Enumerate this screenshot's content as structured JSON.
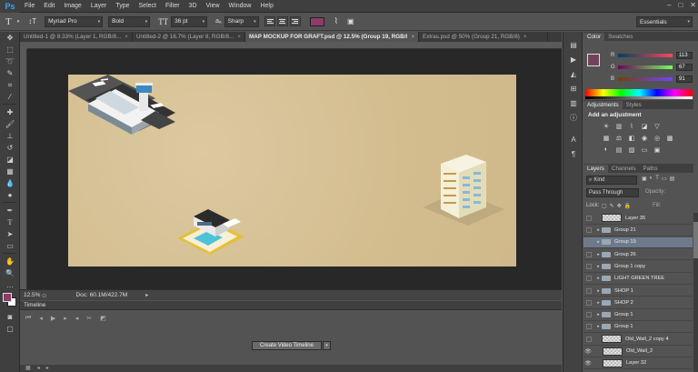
{
  "app": {
    "logo": "Ps"
  },
  "menu": [
    "File",
    "Edit",
    "Image",
    "Layer",
    "Type",
    "Select",
    "Filter",
    "3D",
    "View",
    "Window",
    "Help"
  ],
  "window_controls": [
    "–",
    "□",
    "✕"
  ],
  "options": {
    "font_family": "Myriad Pro",
    "font_style": "Bold",
    "font_size": "36 pt",
    "aa": "aₐ",
    "antialias": "Sharp",
    "text_color": "#8e3b6b",
    "workspace": "Essentials"
  },
  "tabs": [
    {
      "label": "Untitled-1 @ 8.33% (Layer 1, RGB/8...",
      "active": false
    },
    {
      "label": "Untitled-2 @ 16.7% (Layer 8, RGB/8...",
      "active": false
    },
    {
      "label": "MAP MOCKUP FOR GRAFT.psd @ 12.5% (Group 19, RGB/8) *",
      "active": true
    },
    {
      "label": "Extras.psd @ 50% (Group 21, RGB/8)",
      "active": false
    }
  ],
  "status": {
    "zoom": "12.5%",
    "doc": "Doc: 60.1M/422.7M"
  },
  "timeline": {
    "title": "Timeline",
    "create_button": "Create Video Timeline"
  },
  "color_panel": {
    "tabs": [
      "Color",
      "Swatches"
    ],
    "r_label": "R",
    "r": "113",
    "g_label": "G",
    "g": "67",
    "b_label": "B",
    "b": "91"
  },
  "adjustments": {
    "tabs": [
      "Adjustments",
      "Styles"
    ],
    "heading": "Add an adjustment"
  },
  "layers_panel": {
    "tabs": [
      "Layers",
      "Channels",
      "Paths"
    ],
    "filter": "Kind",
    "blend_mode": "Pass Through",
    "opacity_label": "Opacity:",
    "lock_label": "Lock:",
    "fill_label": "Fill:",
    "layers": [
      {
        "name": "Layer 35",
        "type": "layer",
        "eye": false,
        "selected": false
      },
      {
        "name": "Group 21",
        "type": "group",
        "eye": false,
        "selected": false
      },
      {
        "name": "Group 19",
        "type": "group",
        "eye": false,
        "selected": true
      },
      {
        "name": "Group 26",
        "type": "group",
        "eye": false,
        "selected": false
      },
      {
        "name": "Group 1 copy",
        "type": "group",
        "eye": false,
        "selected": false
      },
      {
        "name": "LIGHT GREEN TREE",
        "type": "group",
        "eye": false,
        "selected": false
      },
      {
        "name": "SHOP 1",
        "type": "group",
        "eye": false,
        "selected": false
      },
      {
        "name": "SHOP 2",
        "type": "group",
        "eye": false,
        "selected": false
      },
      {
        "name": "Group 1",
        "type": "group",
        "eye": false,
        "selected": false
      },
      {
        "name": "Group 1",
        "type": "group",
        "eye": false,
        "selected": false
      },
      {
        "name": "Old_Wall_2 copy 4",
        "type": "layer",
        "eye": false,
        "selected": false
      },
      {
        "name": "Old_Wall_2",
        "type": "layer",
        "eye": true,
        "selected": false
      },
      {
        "name": "Layer 32",
        "type": "layer",
        "eye": true,
        "selected": false
      }
    ]
  }
}
